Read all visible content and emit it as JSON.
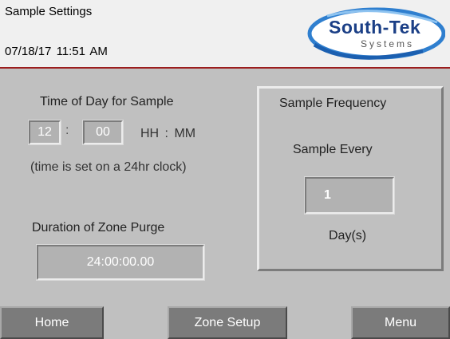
{
  "header": {
    "title": "Sample Settings",
    "date": "07/18/17",
    "time": "11:51 AM",
    "accent_line_color": "#9c1e1e"
  },
  "logo": {
    "name": "South-Tek",
    "tagline": "Systems"
  },
  "time_of_day": {
    "label": "Time of Day for Sample",
    "hours": "12",
    "separator": ":",
    "minutes": "00",
    "format_label": "HH : MM",
    "note": "(time is set on a 24hr clock)"
  },
  "purge": {
    "label": "Duration of Zone Purge",
    "value": "24:00:00.00"
  },
  "frequency": {
    "title": "Sample Frequency",
    "label": "Sample Every",
    "value": "1",
    "unit": "Day(s)"
  },
  "footer": {
    "home_label": "Home",
    "zone_setup_label": "Zone Setup",
    "menu_label": "Menu"
  }
}
